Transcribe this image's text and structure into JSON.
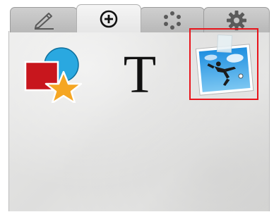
{
  "tabs": [
    {
      "name": "pen-tab",
      "icon": "pen-icon",
      "active": false
    },
    {
      "name": "add-tab",
      "icon": "plus-circle-icon",
      "active": true
    },
    {
      "name": "dots-tab",
      "icon": "dots-circle-icon",
      "active": false
    },
    {
      "name": "settings-tab",
      "icon": "gear-icon",
      "active": false
    }
  ],
  "items": {
    "shapes": {
      "icon": "shapes-icon"
    },
    "text": {
      "glyph": "T"
    },
    "photo": {
      "icon": "photo-icon",
      "selected": true
    }
  },
  "colors": {
    "selection": "#e8141b",
    "shape_red": "#c8161d",
    "shape_blue": "#2aa8e0",
    "shape_star": "#f5a623"
  }
}
